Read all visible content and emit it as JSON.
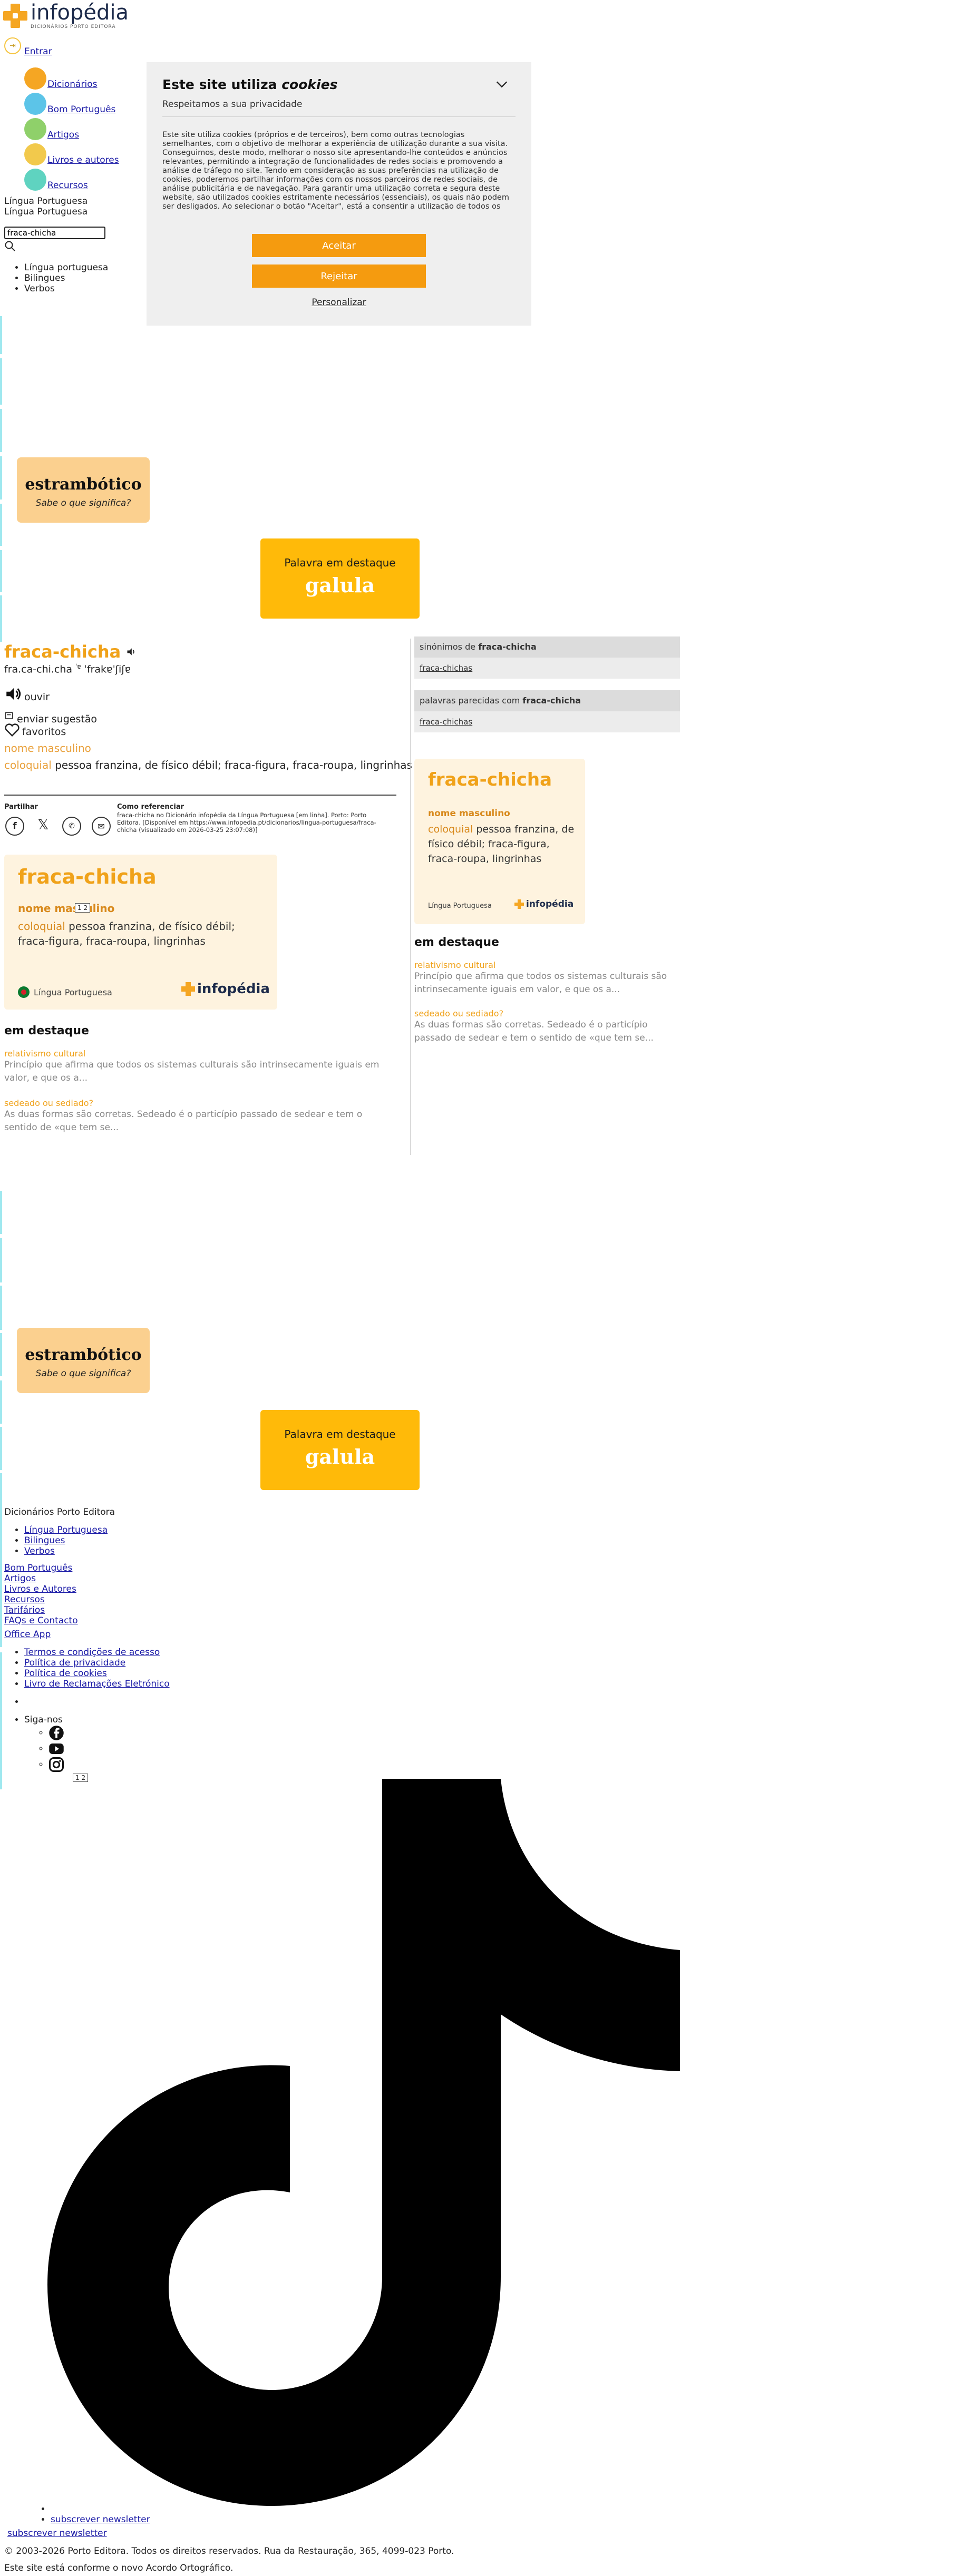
{
  "header": {
    "logo_text": "infopédia",
    "logo_sub": "DICIONÁRIOS PORTO EDITORA",
    "login_label": "Entrar"
  },
  "nav": {
    "items": [
      {
        "label": "Dicionários",
        "color": "#f5a623"
      },
      {
        "label": "Bom Português",
        "color": "#5cc4e8"
      },
      {
        "label": "Artigos",
        "color": "#8fd06a"
      },
      {
        "label": "Livros e autores",
        "color": "#f2c94c"
      },
      {
        "label": "Recursos",
        "color": "#5fd3c0"
      }
    ]
  },
  "language": {
    "line1": "Língua Portuguesa",
    "line2": "Língua Portuguesa",
    "options": [
      "Língua portuguesa",
      "Bilingues",
      "Verbos"
    ]
  },
  "search": {
    "value": "fraca-chicha"
  },
  "cookie_banner": {
    "title_plain": "Este site utiliza ",
    "title_em": "cookies",
    "subtitle": "Respeitamos a sua privacidade",
    "body": "Este site utiliza cookies (próprios e de terceiros), bem como outras tecnologias semelhantes, com o objetivo de melhorar a experiência de utilização durante a sua visita. Conseguimos, deste modo, melhorar o nosso site apresentando-lhe conteúdos e anúncios relevantes, permitindo a integração de funcionalidades de redes sociais e promovendo a análise de tráfego no site. Tendo em consideração as suas preferências na utilização de cookies, poderemos partilhar informações com os nossos parceiros de redes sociais, de análise publicitária e de navegação. Para garantir uma utilização correta e segura deste website, são utilizados cookies estritamente necessários (essenciais), os quais não podem ser desligados. Ao selecionar o botão \"Aceitar\", está a consentir a utilização de todos os cookies. Ao",
    "accept": "Aceitar",
    "reject": "Rejeitar",
    "customize": "Personalizar"
  },
  "promos": {
    "word_card": {
      "word": "estrambótico",
      "question": "Sabe o que significa?"
    },
    "featured": {
      "title": "Palavra em destaque",
      "word": "galula"
    }
  },
  "entry": {
    "headword": "fraca-chicha",
    "syllables": "fra.ca-chi.cha",
    "ipa_prefix": "ˈɐ",
    "ipa": "ˈfrakɐˈʃiʃɐ",
    "listen": "ouvir",
    "suggest": "enviar sugestão",
    "favorites": "favoritos",
    "grammar": "nome masculino",
    "register": "coloquial",
    "definition": " pessoa franzina, de físico débil; fraca-figura, fraca-roupa, lingrinhas"
  },
  "share": {
    "label": "Partilhar",
    "icons": [
      "facebook-icon",
      "x-icon",
      "whatsapp-icon",
      "email-icon"
    ],
    "ref_label": "Como referenciar",
    "ref_text": "fraca-chicha no Dicionário infopédia da Língua Portuguesa [em linha]. Porto: Porto Editora. [Disponível em https://www.infopedia.pt/dicionarios/lingua-portuguesa/fraca-chicha (visualizado em 2026-03-25 23:07:08)]"
  },
  "word_card": {
    "headword": "fraca-chicha",
    "grammar": "nome masculino",
    "register": "coloquial",
    "definition": " pessoa franzina, de físico débil; fraca-figura, fraca-roupa, lingrinhas",
    "language": "Língua Portuguesa",
    "logo": "infopédia",
    "badge": "1 2"
  },
  "highlights": {
    "title": "em destaque",
    "items": [
      {
        "title": "relativismo cultural",
        "text": "Princípio que afirma que todos os sistemas culturais são intrinsecamente iguais em valor, e que os a..."
      },
      {
        "title": "sedeado ou sediado?",
        "text": "As duas formas são corretas. Sedeado é o particípio passado de sedear e tem o sentido de «que tem se..."
      }
    ]
  },
  "sidebar": {
    "synonyms_prefix": "sinónimos de ",
    "synonyms_word": "fraca-chicha",
    "synonyms_item": "fraca-chichas",
    "similar_prefix": "palavras parecidas com ",
    "similar_word": "fraca-chicha",
    "similar_item": "fraca-chichas"
  },
  "footer": {
    "heading": "Dicionários Porto Editora",
    "dict_links": [
      "Língua Portuguesa",
      "Bilingues",
      "Verbos"
    ],
    "links": [
      "Bom Português",
      "Artigos",
      "Livros e Autores",
      "Recursos",
      "Tarifários",
      "FAQs e Contacto"
    ],
    "office_app": "Office App",
    "legal_links": [
      "Termos e condições de acesso",
      "Política de privacidade",
      "Política de cookies",
      "Livro de Reclamações Eletrónico"
    ],
    "follow": "Siga-nos",
    "social": [
      "facebook-icon",
      "youtube-icon",
      "instagram-icon",
      "tiktok-icon"
    ],
    "badge": "1 2",
    "newsletter_item": "subscrever newsletter",
    "newsletter": "subscrever newsletter",
    "copyright": "© 2003-2026 Porto Editora. Todos os direitos reservados. Rua da Restauração, 365, 4099-023 Porto.",
    "agreement": "Este site está conforme o novo Acordo Ortográfico."
  }
}
